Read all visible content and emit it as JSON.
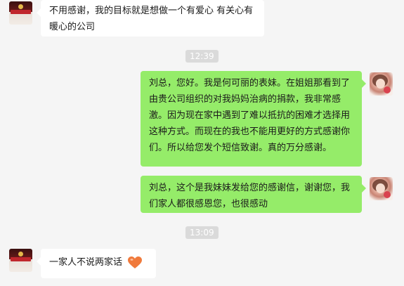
{
  "messages": [
    {
      "side": "left",
      "text": "不用感谢，我的目标就是想做一个有爱心 有关心有暖心的公司"
    },
    {
      "side": "right",
      "text": "刘总，您好。我是何可丽的表妹。在姐姐那看到了由贵公司组织的对我妈妈治病的捐款，我非常感激。因为现在家中遇到了难以抵抗的困难才选择用这种方式。而现在的我也不能用更好的方式感谢你们。所以给您发个短信致谢。真的万分感谢。"
    },
    {
      "side": "right",
      "text": "刘总，这个是我妹妹发给您的感谢信，谢谢您，我们家人都很感恩您，也很感动"
    },
    {
      "side": "left",
      "text": "一家人不说两家话",
      "emoji": "heart-emoji"
    }
  ],
  "times": [
    "12:39",
    "13:09"
  ],
  "colors": {
    "background": "#f5f5f5",
    "sent_bubble": "#95ec69",
    "received_bubble": "#ffffff",
    "time_badge": "#dadada",
    "heart": "#f07a3c"
  }
}
